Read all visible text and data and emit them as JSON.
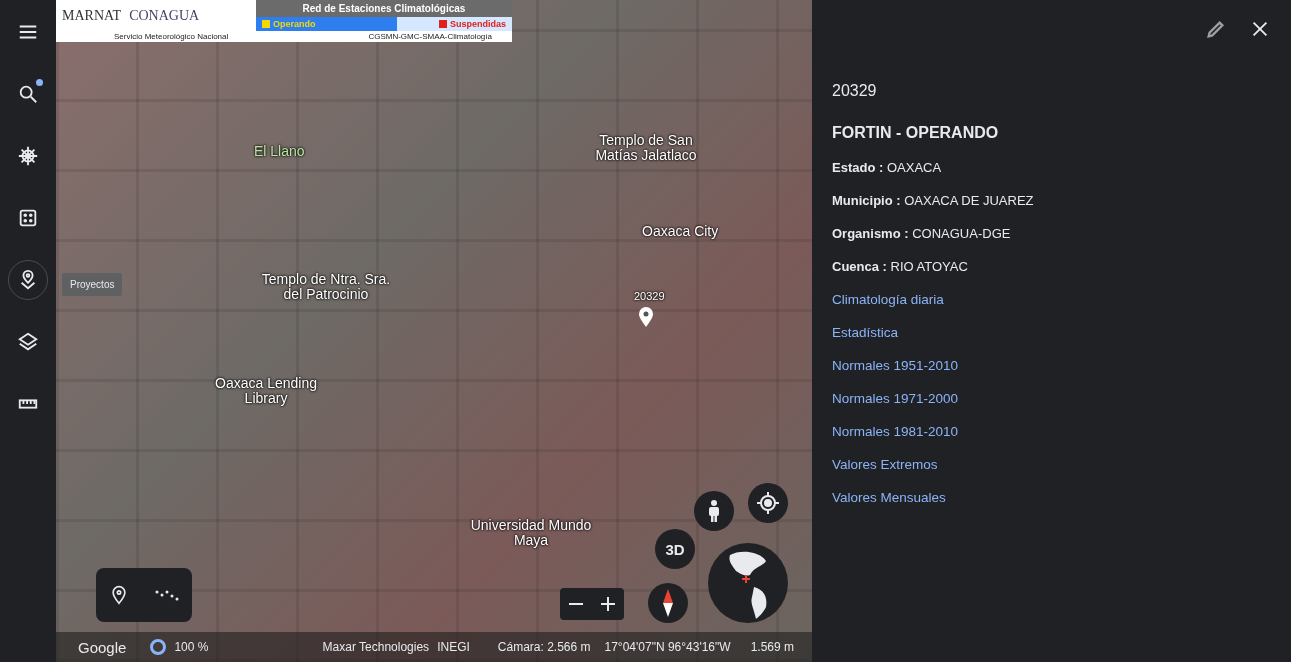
{
  "sidebar": {
    "items": [
      {
        "kind": "menu",
        "selected": false,
        "dot": false
      },
      {
        "kind": "search",
        "selected": false,
        "dot": true
      },
      {
        "kind": "wheel",
        "selected": false,
        "dot": false
      },
      {
        "kind": "dice",
        "selected": false,
        "dot": false
      },
      {
        "kind": "projects",
        "selected": true,
        "dot": false
      },
      {
        "kind": "layers",
        "selected": false,
        "dot": false
      },
      {
        "kind": "ruler",
        "selected": false,
        "dot": false
      }
    ],
    "tooltip": "Proyectos"
  },
  "map": {
    "banner": {
      "logo_left": "MARNAT",
      "logo_right": "CONAGUA",
      "title": "Red de Estaciones Climatológicas",
      "legend": [
        {
          "label": "Operando",
          "color": "#f5d800"
        },
        {
          "label": "Suspendidas",
          "color": "#e0201a"
        }
      ],
      "subtitle_left": "Servicio Meteorológico Nacional",
      "subtitle_right": "CGSMN-GMC-SMAA-Climatología"
    },
    "labels": [
      {
        "text": "El Llano",
        "kind": "park"
      },
      {
        "text": "Templo de San Matías Jalatlaco",
        "kind": "place"
      },
      {
        "text": "Oaxaca City",
        "kind": "place"
      },
      {
        "text": "Templo de Ntra. Sra. del Patrocinio",
        "kind": "place"
      },
      {
        "text": "Oaxaca Lending Library",
        "kind": "place"
      },
      {
        "text": "Universidad Mundo Maya",
        "kind": "place"
      },
      {
        "text": "20329",
        "kind": "marker"
      }
    ],
    "controls": {
      "view_3d": "3D"
    },
    "status_bar": {
      "brand": "Google",
      "load": "100 %",
      "attribution": [
        "Maxar Technologies",
        "INEGI"
      ],
      "camera": "Cámara: 2.566 m",
      "coordinates": "17°04'07\"N 96°43'16\"W",
      "elevation": "1.569 m"
    }
  },
  "panel": {
    "id": "20329",
    "title": "FORTIN - OPERANDO",
    "fields": [
      {
        "label": "Estado :",
        "value": "OAXACA"
      },
      {
        "label": "Municipio :",
        "value": "OAXACA DE JUAREZ"
      },
      {
        "label": "Organismo :",
        "value": "CONAGUA-DGE"
      },
      {
        "label": "Cuenca :",
        "value": "RIO ATOYAC"
      }
    ],
    "links": [
      "Climatología diaria",
      "Estadística",
      "Normales 1951-2010",
      "Normales 1971-2000",
      "Normales 1981-2010",
      "Valores Extremos",
      "Valores Mensuales"
    ]
  }
}
